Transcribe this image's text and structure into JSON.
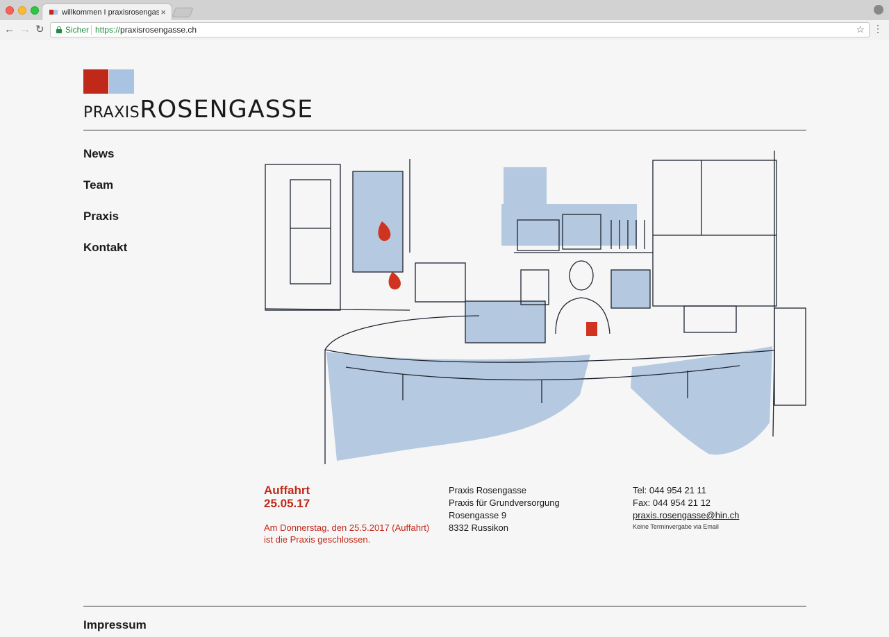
{
  "browser": {
    "tab_title": "willkommen I praxisrosengasse",
    "tab_close": "×",
    "secure_label": "Sicher",
    "url_protocol": "https://",
    "url_host": "praxisrosengasse.ch",
    "colors": {
      "secure_green": "#1e8e3e"
    },
    "icons": [
      "back-arrow-icon",
      "forward-arrow-icon",
      "reload-icon",
      "lock-icon",
      "star-icon",
      "menu-dots-icon",
      "profile-icon"
    ]
  },
  "site": {
    "logo": {
      "small": "PRAXIS",
      "big": "ROSENGASSE",
      "colors": {
        "red": "#c0291a",
        "blue": "#a9c4e2"
      }
    },
    "nav": [
      {
        "label": "News"
      },
      {
        "label": "Team"
      },
      {
        "label": "Praxis"
      },
      {
        "label": "Kontakt"
      }
    ],
    "news": {
      "title": "Auffahrt",
      "date": "25.05.17",
      "body_line1": "Am Donnerstag, den 25.5.2017 (Auffahrt)",
      "body_line2": "ist die Praxis geschlossen."
    },
    "address": {
      "line1": "Praxis Rosengasse",
      "line2": "Praxis für Grundversorgung",
      "line3": "Rosengasse 9",
      "line4": "8332 Russikon"
    },
    "contact": {
      "tel": "Tel: 044 954 21 11",
      "fax": "Fax: 044 954 21 12",
      "email": "praxis.rosengasse@hin.ch",
      "note": "Keine Terminvergabe via Email"
    },
    "footer": {
      "impressum": "Impressum"
    },
    "accent_color": "#c0291a"
  }
}
